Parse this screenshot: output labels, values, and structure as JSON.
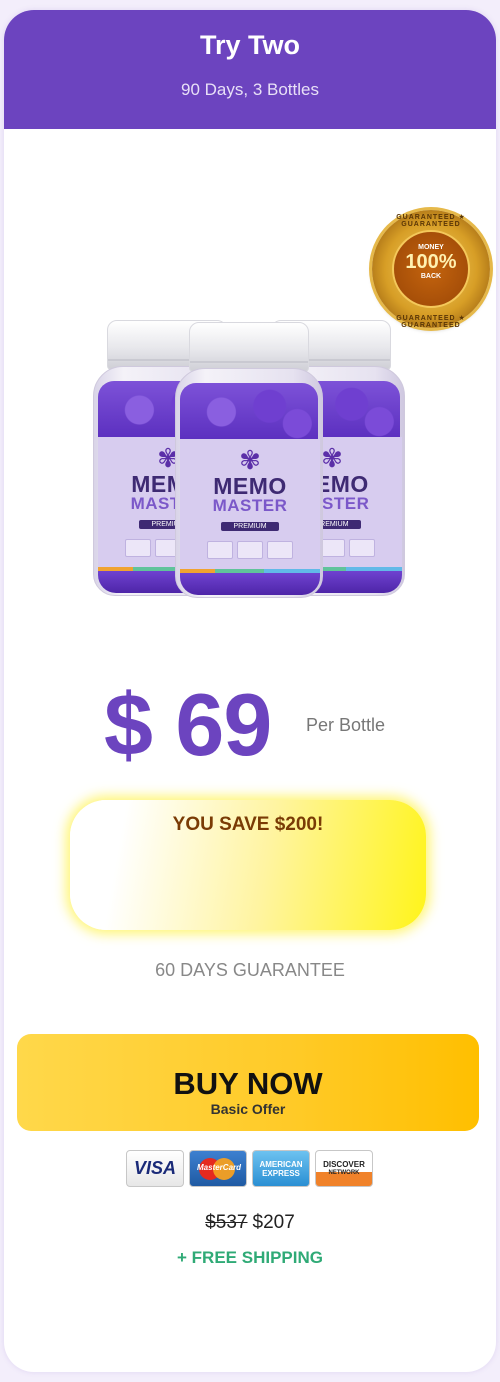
{
  "header": {
    "title": "Try Two",
    "subtitle": "90 Days, 3 Bottles"
  },
  "product": {
    "brand_line1": "MEMO",
    "brand_line2": "MASTER",
    "variant": "PREMIUM"
  },
  "seal": {
    "ring_top": "GUARANTEED ★ GUARANTEED",
    "money": "MONEY",
    "percent": "100%",
    "back": "BACK",
    "ring_bottom": "GUARANTEED ★ GUARANTEED"
  },
  "price": {
    "amount": "$ 69",
    "unit": "Per Bottle"
  },
  "savings": {
    "text": "YOU SAVE $200!"
  },
  "guarantee": "60 DAYS GUARANTEE",
  "buy_button": {
    "label": "BUY NOW",
    "sublabel": "Basic Offer"
  },
  "payment_methods": {
    "visa": "VISA",
    "mastercard": "MasterCard",
    "amex_line1": "AMERICAN",
    "amex_line2": "EXPRESS",
    "discover_line1": "DISCOVER",
    "discover_line2": "NETWORK"
  },
  "totals": {
    "original": "$537",
    "current": "$207"
  },
  "shipping": "+ FREE SHIPPING",
  "colors": {
    "brand_purple": "#6c44bf",
    "button_yellow": "#ffc727",
    "shipping_green": "#2faa76"
  }
}
